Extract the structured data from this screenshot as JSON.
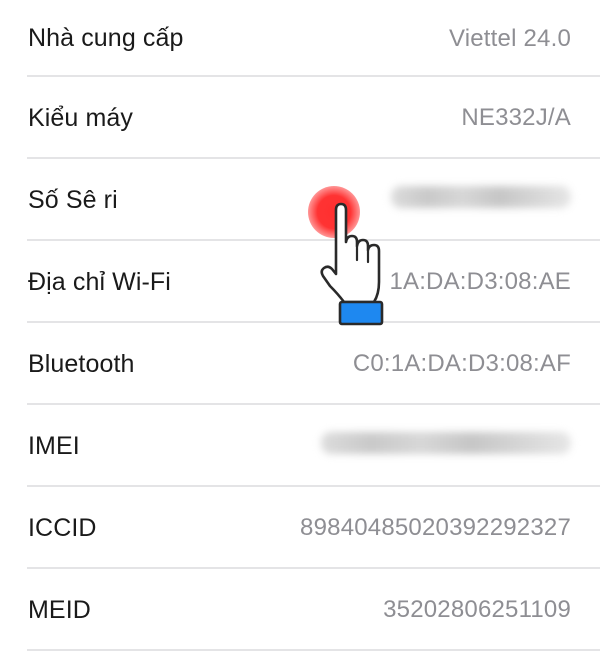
{
  "screen": "About (Giới thiệu) device info",
  "rows": [
    {
      "label": "Nhà cung cấp",
      "value": "Viettel 24.0",
      "blurred": false
    },
    {
      "label": "Kiểu máy",
      "value": "NE332J/A",
      "blurred": false
    },
    {
      "label": "Số Sê ri",
      "value": "",
      "blurred": true
    },
    {
      "label": "Địa chỉ Wi-Fi",
      "value": "C0:1A:DA:D3:08:AE",
      "value_visible": "1A:DA:D3:08:AE",
      "blurred": false
    },
    {
      "label": "Bluetooth",
      "value": "C0:1A:DA:D3:08:AF",
      "blurred": false
    },
    {
      "label": "IMEI",
      "value": "",
      "blurred": true
    },
    {
      "label": "ICCID",
      "value": "89840485020392292327",
      "blurred": false
    },
    {
      "label": "MEID",
      "value": "35202806251109",
      "blurred": false
    }
  ],
  "overlay": {
    "icon": "hand-pointer-icon",
    "tap_indicator": "red-tap-dot",
    "target_row": "Số Sê ri"
  },
  "colors": {
    "label": "#1a1a1a",
    "value": "#8e8e93",
    "separator": "#e4e4e6",
    "tap_dot": "#ff3030",
    "cuff": "#1e88f0"
  }
}
